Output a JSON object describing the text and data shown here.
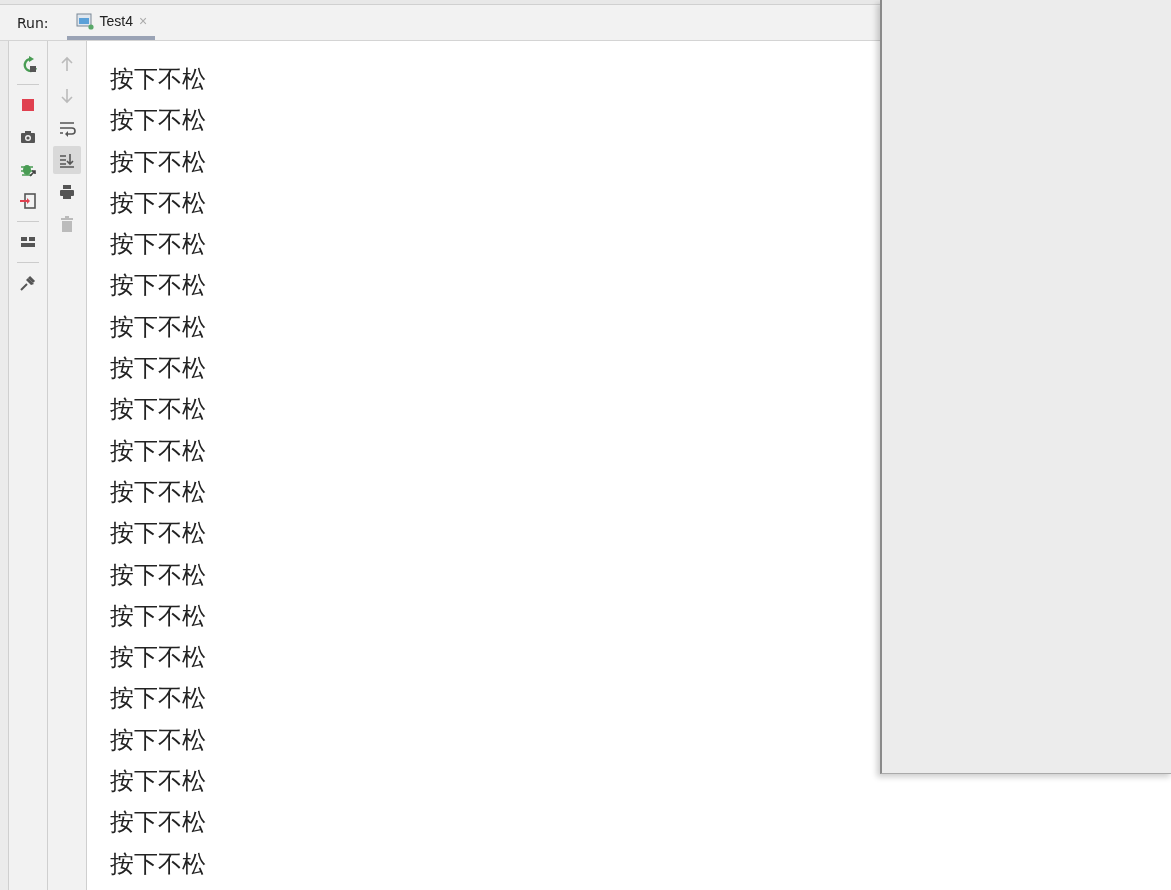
{
  "run_panel": {
    "label": "Run:",
    "tabs": [
      {
        "label": "Test4",
        "close": "×",
        "selected": true
      }
    ]
  },
  "console_toolbar": [
    {
      "on": false,
      "disabled": true
    },
    {
      "on": false,
      "disabled": true
    },
    {
      "on": false,
      "disabled": false
    },
    {
      "on": true,
      "disabled": false
    },
    {
      "on": false,
      "disabled": false
    },
    {
      "on": false,
      "disabled": true
    }
  ],
  "console_lines": [
    "按下不松",
    "按下不松",
    "按下不松",
    "按下不松",
    "按下不松",
    "按下不松",
    "按下不松",
    "按下不松",
    "按下不松",
    "按下不松",
    "按下不松",
    "按下不松",
    "按下不松",
    "按下不松",
    "按下不松",
    "按下不松",
    "按下不松",
    "按下不松",
    "按下不松",
    "按下不松"
  ]
}
